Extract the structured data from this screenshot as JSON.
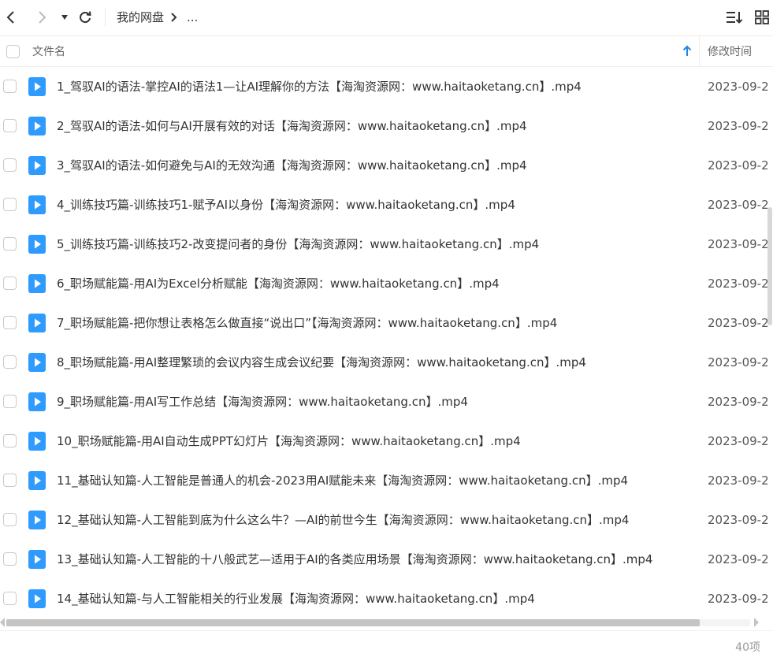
{
  "toolbar": {
    "breadcrumb": [
      "我的网盘",
      "..."
    ]
  },
  "header": {
    "col_name": "文件名",
    "col_modified": "修改时间",
    "sort_icon": "arrow-up-icon"
  },
  "files": [
    {
      "name": "1_驾驭AI的语法-掌控AI的语法1—让AI理解你的方法【海淘资源网：www.haitaoketang.cn】.mp4",
      "modified": "2023-09-2"
    },
    {
      "name": "2_驾驭AI的语法-如何与AI开展有效的对话【海淘资源网：www.haitaoketang.cn】.mp4",
      "modified": "2023-09-2"
    },
    {
      "name": "3_驾驭AI的语法-如何避免与AI的无效沟通【海淘资源网：www.haitaoketang.cn】.mp4",
      "modified": "2023-09-2"
    },
    {
      "name": "4_训练技巧篇-训练技巧1-赋予AI以身份【海淘资源网：www.haitaoketang.cn】.mp4",
      "modified": "2023-09-2"
    },
    {
      "name": "5_训练技巧篇-训练技巧2-改变提问者的身份【海淘资源网：www.haitaoketang.cn】.mp4",
      "modified": "2023-09-2"
    },
    {
      "name": "6_职场赋能篇-用AI为Excel分析赋能【海淘资源网：www.haitaoketang.cn】.mp4",
      "modified": "2023-09-2"
    },
    {
      "name": "7_职场赋能篇-把你想让表格怎么做直接“说出口”【海淘资源网：www.haitaoketang.cn】.mp4",
      "modified": "2023-09-2"
    },
    {
      "name": "8_职场赋能篇-用AI整理繁琐的会议内容生成会议纪要【海淘资源网：www.haitaoketang.cn】.mp4",
      "modified": "2023-09-2"
    },
    {
      "name": "9_职场赋能篇-用AI写工作总结【海淘资源网：www.haitaoketang.cn】.mp4",
      "modified": "2023-09-2"
    },
    {
      "name": "10_职场赋能篇-用AI自动生成PPT幻灯片【海淘资源网：www.haitaoketang.cn】.mp4",
      "modified": "2023-09-2"
    },
    {
      "name": "11_基础认知篇-人工智能是普通人的机会-2023用AI赋能未来【海淘资源网：www.haitaoketang.cn】.mp4",
      "modified": "2023-09-2"
    },
    {
      "name": "12_基础认知篇-人工智能到底为什么这么牛？—AI的前世今生【海淘资源网：www.haitaoketang.cn】.mp4",
      "modified": "2023-09-2"
    },
    {
      "name": "13_基础认知篇-人工智能的十八般武艺—适用于AI的各类应用场景【海淘资源网：www.haitaoketang.cn】.mp4",
      "modified": "2023-09-2"
    },
    {
      "name": "14_基础认知篇-与人工智能相关的行业发展【海淘资源网：www.haitaoketang.cn】.mp4",
      "modified": "2023-09-2"
    }
  ],
  "footer": {
    "count": "40项"
  },
  "colors": {
    "accent": "#1e88e5",
    "file_icon": "#2f9bff"
  }
}
